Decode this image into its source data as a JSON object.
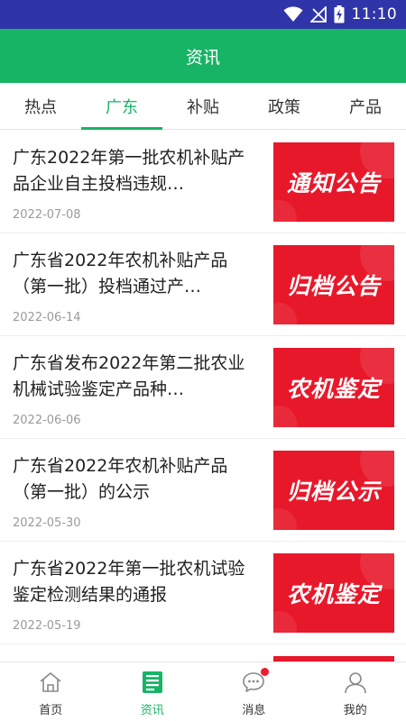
{
  "status_bar": {
    "time": "11:10",
    "icons": [
      "wifi-icon",
      "signal-off-icon",
      "battery-charging-icon"
    ]
  },
  "header": {
    "title": "资讯"
  },
  "tabs": [
    {
      "label": "热点",
      "active": false
    },
    {
      "label": "广东",
      "active": true
    },
    {
      "label": "补贴",
      "active": false
    },
    {
      "label": "政策",
      "active": false
    },
    {
      "label": "产品",
      "active": false
    }
  ],
  "news": [
    {
      "title": "广东2022年第一批农机补贴产品企业自主投档违规…",
      "date": "2022-07-08",
      "thumb_label": "通知公告"
    },
    {
      "title": "广东省2022年农机补贴产品（第一批）投档通过产…",
      "date": "2022-06-14",
      "thumb_label": "归档公告"
    },
    {
      "title": "广东省发布2022年第二批农业机械试验鉴定产品种…",
      "date": "2022-06-06",
      "thumb_label": "农机鉴定"
    },
    {
      "title": "广东省2022年农机补贴产品（第一批）的公示",
      "date": "2022-05-30",
      "thumb_label": "归档公示"
    },
    {
      "title": "广东省2022年第一批农机试验鉴定检测结果的通报",
      "date": "2022-05-19",
      "thumb_label": "农机鉴定"
    }
  ],
  "colors": {
    "status_bar": "#2f35a8",
    "brand_green": "#17b465",
    "thumb_red": "#e8182b",
    "badge_red": "#f21a2d"
  },
  "bottom_nav": [
    {
      "label": "首页",
      "icon": "home-icon",
      "active": false,
      "badge": false
    },
    {
      "label": "资讯",
      "icon": "news-icon",
      "active": true,
      "badge": false
    },
    {
      "label": "消息",
      "icon": "chat-bubble-icon",
      "active": false,
      "badge": true
    },
    {
      "label": "我的",
      "icon": "user-icon",
      "active": false,
      "badge": false
    }
  ]
}
